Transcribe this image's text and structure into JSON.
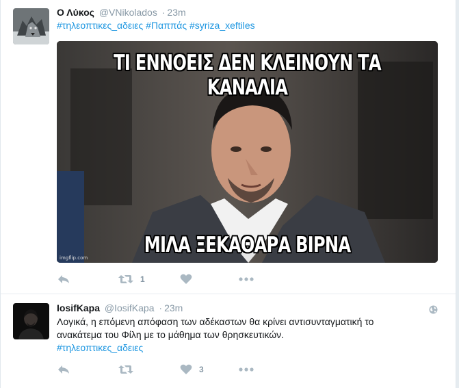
{
  "tweets": [
    {
      "fullname": "Ο Λύκος",
      "screen_name": "@VNikolados",
      "dot": "·",
      "time": "23m",
      "hashtags": [
        "#τηλεοπτικες_αδειες",
        "#Παππάς",
        "#syriza_xeftiles"
      ],
      "media": {
        "top_caption": "ΤΙ ΕΝΝΟΕΙΣ ΔΕΝ ΚΛΕΙΝΟΥΝ ΤΑ ΚΑΝΑΛΙΑ",
        "bottom_caption": "ΜΙΛΑ ΞΕΚΑΘΑΡΑ ΒΙΡΝΑ",
        "watermark": "imgflip.com"
      },
      "actions": {
        "reply": "",
        "retweet_count": "1",
        "like_count": "",
        "more": ""
      }
    },
    {
      "fullname": "IosifKapa",
      "screen_name": "@IosifKapa",
      "dot": "·",
      "time": "23m",
      "text_line_1": "Λογικά, η επόμενη απόφαση των αδέκαστων θα κρίνει αντισυνταγματική το",
      "text_line_2": "ανακάτεμα του Φίλη με το μάθημα των θρησκευτικών.",
      "hashtag": "#τηλεοπτικες_αδειες",
      "actions": {
        "reply": "",
        "retweet_count": "",
        "like_count": "3",
        "more": ""
      }
    }
  ],
  "colors": {
    "link": "#1b95e0",
    "text": "#14171a",
    "muted": "#8899a6",
    "icon": "#aab8c2"
  },
  "icons": {
    "reply": "reply-icon",
    "retweet": "retweet-icon",
    "like": "heart-icon",
    "more": "more-dots-icon",
    "location": "globe-icon"
  }
}
